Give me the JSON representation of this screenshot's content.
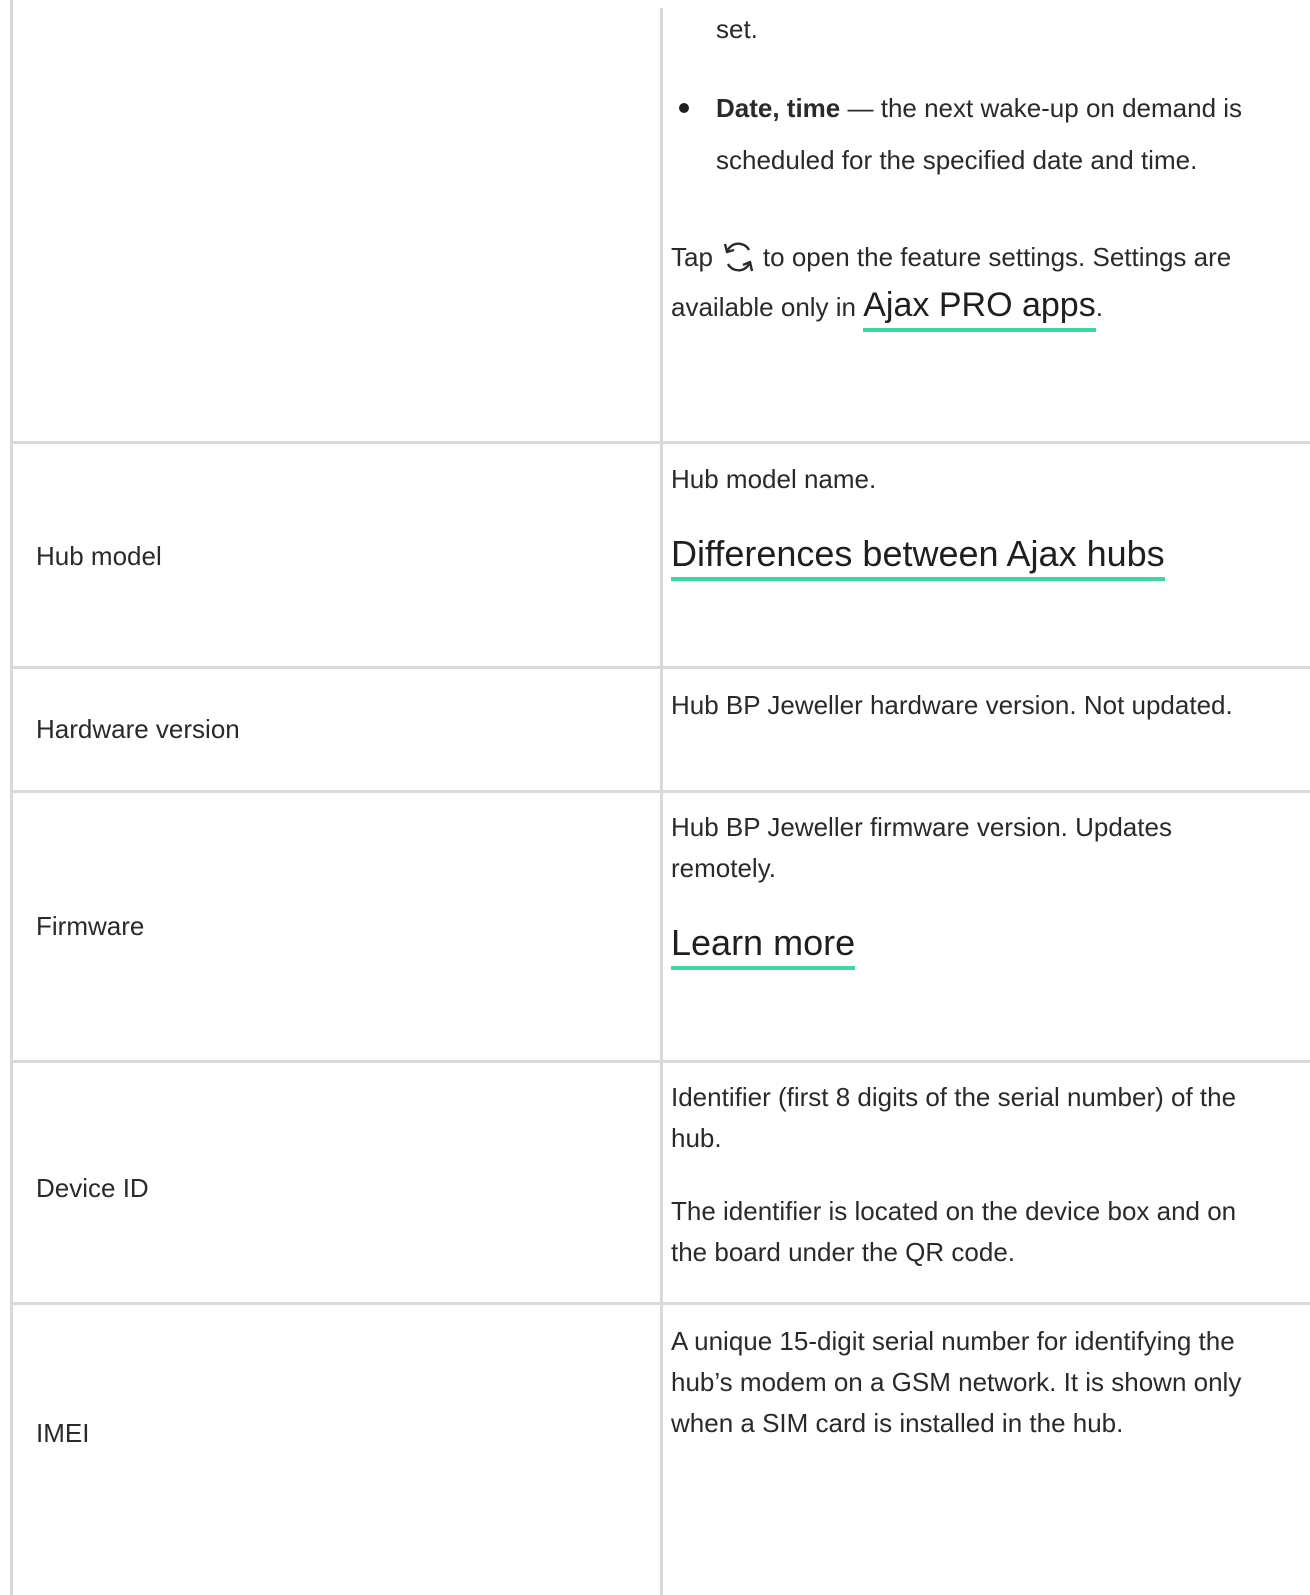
{
  "top_row": {
    "fragment": "set.",
    "bullet": {
      "term": "Date, time",
      "dash": " — ",
      "text": "the next wake-up on demand is scheduled for the specified date and time."
    },
    "tap_prefix": "Tap",
    "tap_suffix": "to open the feature settings. Settings are available only in",
    "icon": "sync-icon",
    "link": "Ajax PRO apps",
    "link_after": "."
  },
  "rows": [
    {
      "label": "Hub model",
      "desc": "Hub model name.",
      "link": "Differences between Ajax hubs"
    },
    {
      "label": "Hardware version",
      "desc": "Hub BP Jeweller hardware version. Not updated."
    },
    {
      "label": "Firmware",
      "desc": "Hub BP Jeweller firmware version. Updates remotely.",
      "link": "Learn more"
    },
    {
      "label": "Device ID",
      "desc": "Identifier (first 8 digits of the serial number) of the hub.",
      "desc2": "The identifier is located on the device box and on the board under the QR code."
    },
    {
      "label": "IMEI",
      "desc": "A unique 15-digit serial number for identifying the hub’s modem on a GSM network. It is shown only when a SIM card is installed in the hub."
    }
  ],
  "colors": {
    "border": "#d9d9d9",
    "link_underline": "#3dd6a5",
    "text": "#2a2a2a"
  }
}
